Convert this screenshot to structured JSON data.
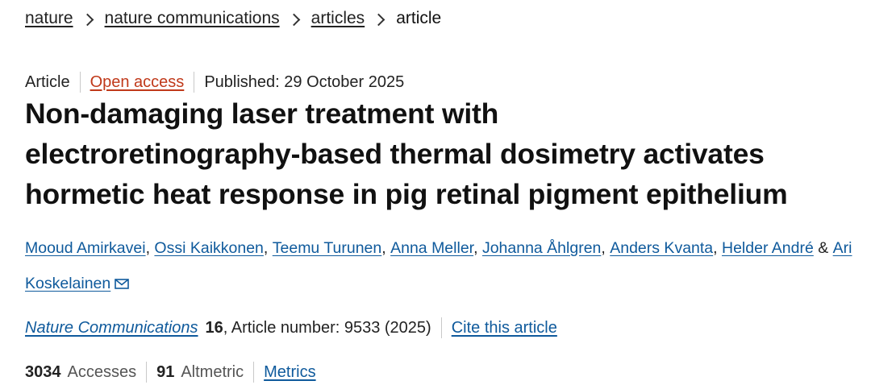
{
  "breadcrumb": {
    "items": [
      {
        "label": "nature"
      },
      {
        "label": "nature communications"
      },
      {
        "label": "articles"
      }
    ],
    "current": "article"
  },
  "meta": {
    "type": "Article",
    "access": "Open access",
    "published": "Published: 29 October 2025"
  },
  "title": {
    "line1": "Non-damaging laser treatment with",
    "line2": "electroretinography-based thermal dosimetry activates",
    "line3": "hormetic heat response in pig retinal pigment epithelium"
  },
  "authors": {
    "list": [
      {
        "name": "Mooud Amirkavei",
        "sep": ", "
      },
      {
        "name": "Ossi Kaikkonen",
        "sep": ", "
      },
      {
        "name": "Teemu Turunen",
        "sep": ", "
      },
      {
        "name": "Anna Meller",
        "sep": ", "
      },
      {
        "name": "Johanna Åhlgren",
        "sep": ", "
      },
      {
        "name": "Anders Kvanta",
        "sep": ", "
      },
      {
        "name": "Helder André",
        "sep": " & "
      },
      {
        "name": "Ari Koskelainen",
        "sep": ""
      }
    ],
    "contact_icon": "envelope-icon"
  },
  "citation": {
    "journal": "Nature Communications",
    "volume": "16",
    "details": ", Article number: 9533 (2025)",
    "cite_link": "Cite this article"
  },
  "metrics": {
    "accesses_count": "3034",
    "accesses_label": "Accesses",
    "altmetric_count": "91",
    "altmetric_label": "Altmetric",
    "metrics_link": "Metrics"
  },
  "colors": {
    "link_blue": "#0f5a9c",
    "open_access_orange": "#c0391a",
    "text": "#222222"
  }
}
